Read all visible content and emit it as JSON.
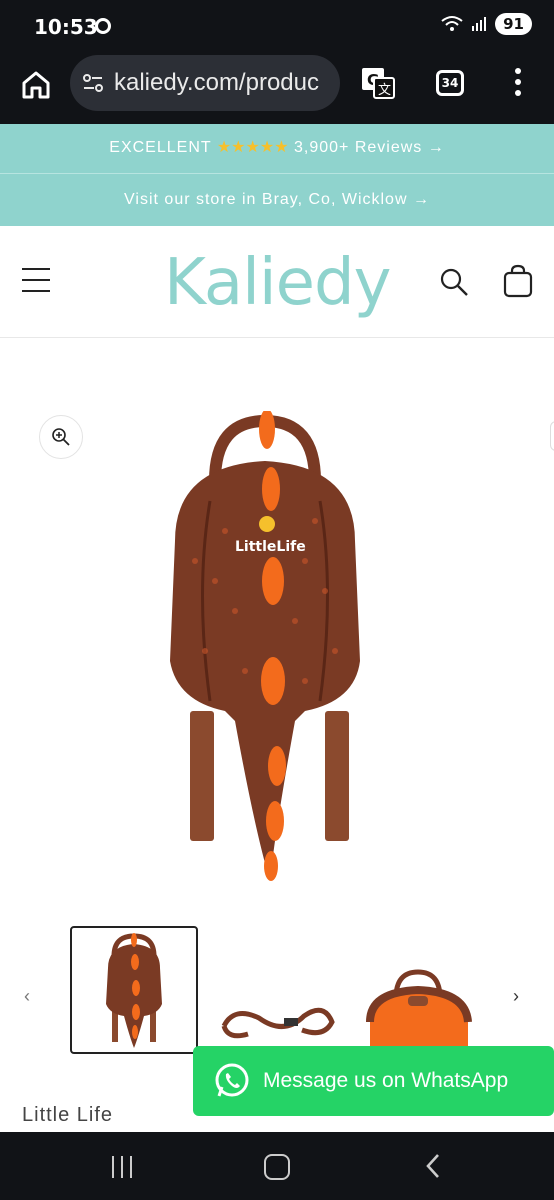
{
  "status": {
    "time": "10:53",
    "battery": "91"
  },
  "browser": {
    "url": "kaliedy.com/produc",
    "tab_count": "34"
  },
  "banner": {
    "reviews_prefix": "EXCELLENT",
    "stars": "★★★★★",
    "reviews_text": "3,900+ Reviews →",
    "store_text": "Visit our store in Bray, Co, Wicklow →"
  },
  "header": {
    "logo": "Kaliedy"
  },
  "product": {
    "brand_mark": "LittleLife",
    "vendor": "Little Life"
  },
  "thumbnails": {
    "prev": "‹",
    "next": "›"
  },
  "whatsapp": {
    "label": "Message us on WhatsApp"
  },
  "colors": {
    "accent": "#8fd3cd",
    "whatsapp": "#25d366",
    "backpack": "#7a3a24",
    "spikes": "#f36b1c"
  }
}
